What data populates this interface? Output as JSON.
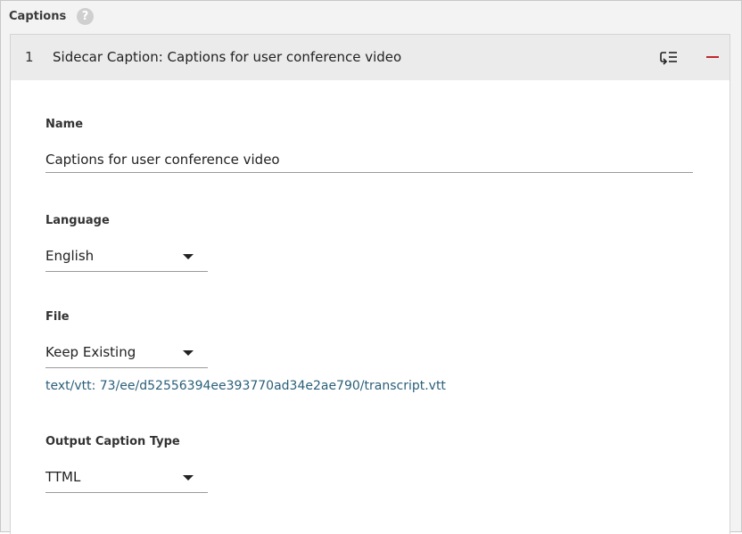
{
  "section": {
    "title": "Captions",
    "help_glyph": "?"
  },
  "item": {
    "index": "1",
    "title": "Sidecar Caption: Captions for user conference video",
    "remove_color": "#c0272d"
  },
  "fields": {
    "name": {
      "label": "Name",
      "value": "Captions for user conference video"
    },
    "language": {
      "label": "Language",
      "value": "English"
    },
    "file": {
      "label": "File",
      "value": "Keep Existing",
      "link": "text/vtt: 73/ee/d52556394ee393770ad34e2ae790/transcript.vtt"
    },
    "output_caption_type": {
      "label": "Output Caption Type",
      "value": "TTML"
    }
  }
}
